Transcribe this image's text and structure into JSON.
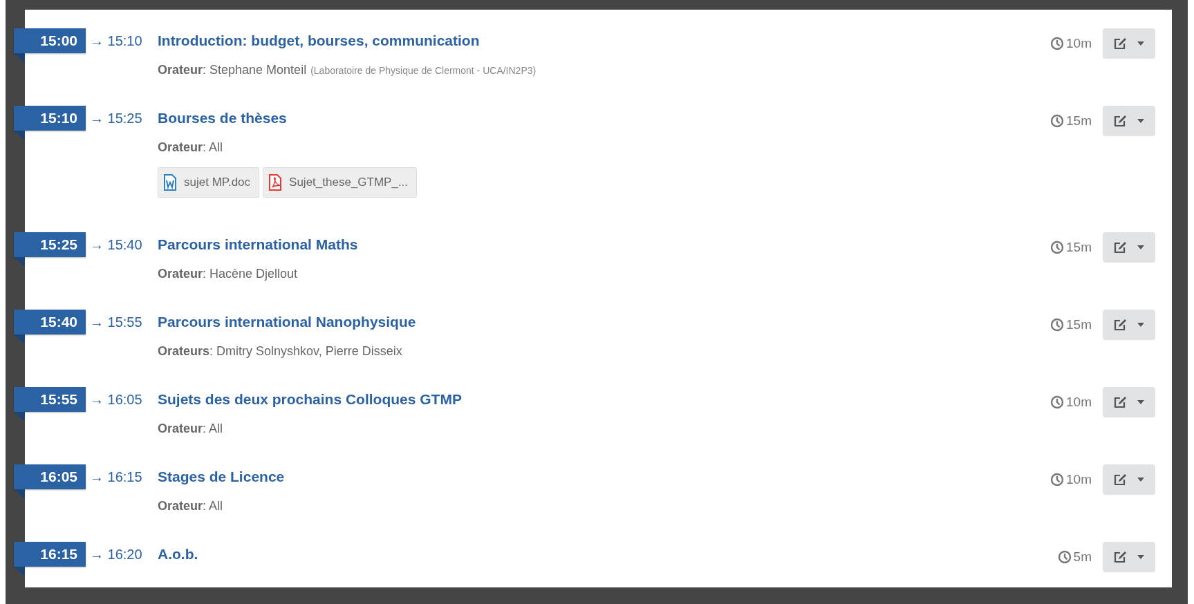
{
  "entries": [
    {
      "start": "15:00",
      "end": "→ 15:10",
      "title": "Introduction: budget, bourses, communication",
      "speaker": "**Orateur**: Stephane Monteil",
      "affiliation": "(Laboratoire de Physique de Clermont - UCA/IN2P3)",
      "duration": "10m"
    },
    {
      "start": "15:10",
      "end": "→ 15:25",
      "title": "Bourses de thèses",
      "speaker": "**Orateur**: All",
      "attachments": [
        {
          "kind": "word",
          "name": "sujet MP.doc"
        },
        {
          "kind": "pdf",
          "name": "Sujet_these_GTMP_..."
        }
      ],
      "duration": "15m"
    },
    {
      "start": "15:25",
      "end": "→ 15:40",
      "title": "Parcours international Maths",
      "speaker": "**Orateur**: Hacène Djellout",
      "duration": "15m"
    },
    {
      "start": "15:40",
      "end": "→ 15:55",
      "title": "Parcours international Nanophysique",
      "speaker": "**Orateurs**: Dmitry Solnyshkov, Pierre Disseix",
      "duration": "15m"
    },
    {
      "start": "15:55",
      "end": "→ 16:05",
      "title": "Sujets des deux prochains Colloques GTMP",
      "speaker": "**Orateur**: All",
      "duration": "10m"
    },
    {
      "start": "16:05",
      "end": "→ 16:15",
      "title": "Stages de Licence",
      "speaker": "**Orateur**: All",
      "duration": "10m"
    },
    {
      "start": "16:15",
      "end": "→ 16:20",
      "title": "A.o.b.",
      "duration": "5m"
    }
  ]
}
